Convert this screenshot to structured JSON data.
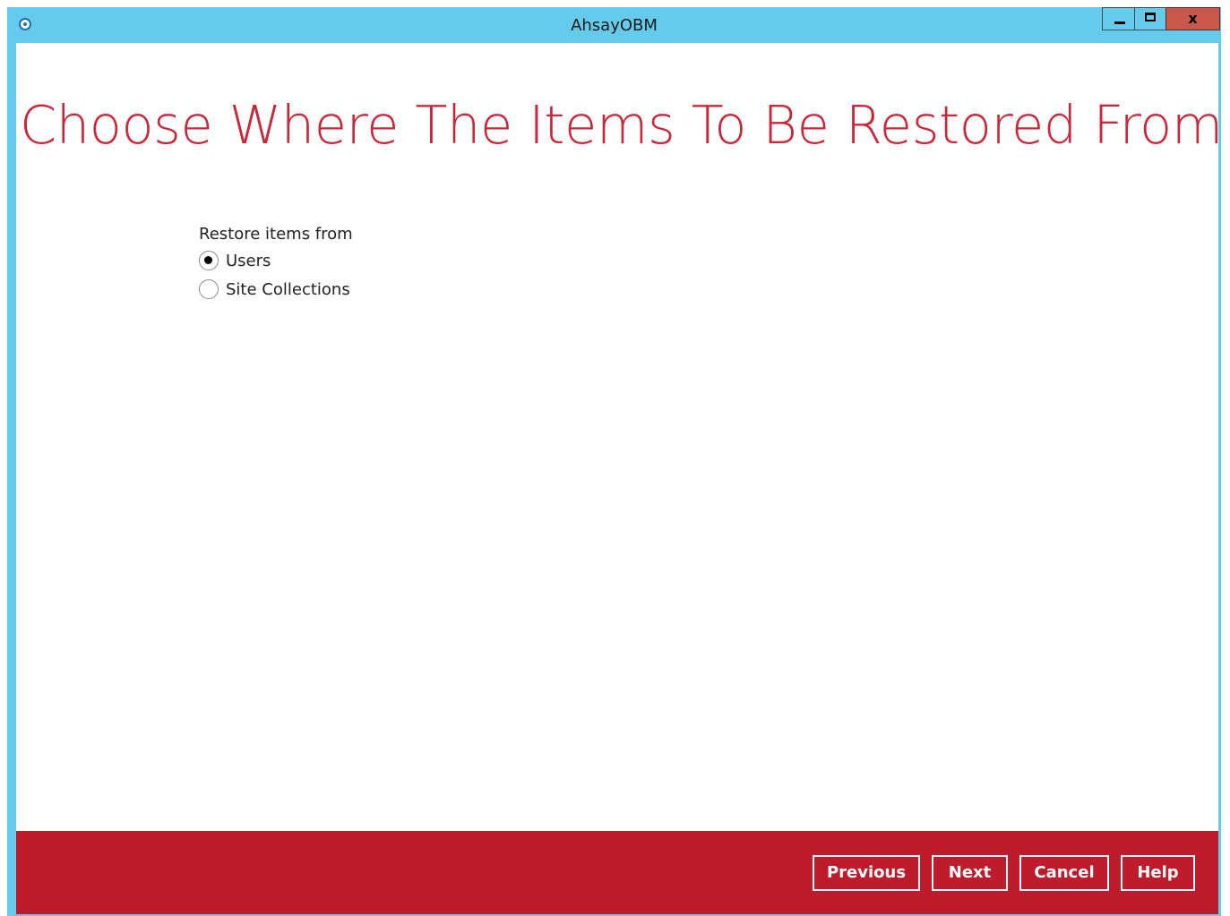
{
  "window": {
    "title": "AhsayOBM",
    "controls": {
      "minimize_icon": "minimize-icon",
      "maximize_icon": "maximize-icon",
      "close_label": "x"
    }
  },
  "page": {
    "title": "Choose Where The Items To Be Restored From"
  },
  "restore_source": {
    "label": "Restore items from",
    "options": [
      {
        "label": "Users",
        "selected": true
      },
      {
        "label": "Site Collections",
        "selected": false
      }
    ]
  },
  "footer": {
    "previous_label": "Previous",
    "next_label": "Next",
    "cancel_label": "Cancel",
    "help_label": "Help"
  },
  "colors": {
    "titlebar": "#66cbea",
    "accent": "#c8283a",
    "footer": "#bd1c2c"
  }
}
